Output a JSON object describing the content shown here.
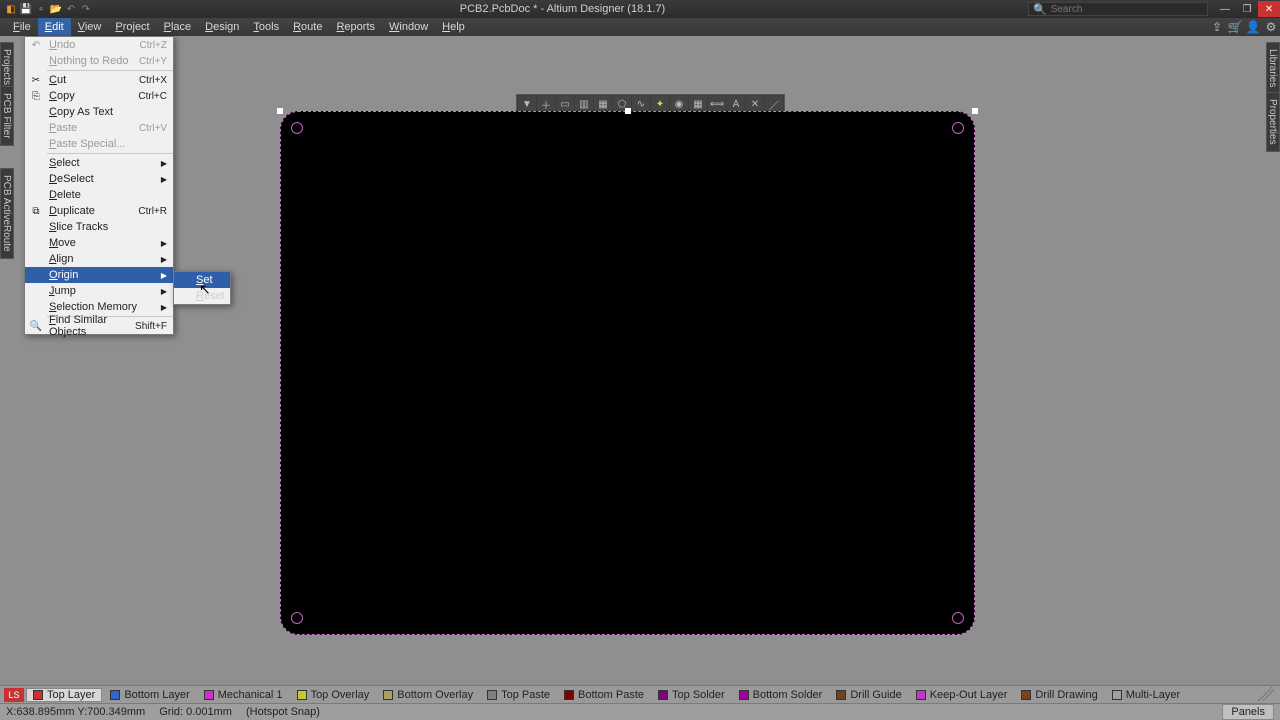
{
  "title": "PCB2.PcbDoc * - Altium Designer (18.1.7)",
  "search_placeholder": "Search",
  "menus": [
    "File",
    "Edit",
    "View",
    "Project",
    "Place",
    "Design",
    "Tools",
    "Route",
    "Reports",
    "Window",
    "Help"
  ],
  "active_menu_index": 1,
  "edit_menu": [
    {
      "label": "Undo",
      "shortcut": "Ctrl+Z",
      "icon": "undo",
      "disabled": true
    },
    {
      "label": "Nothing to Redo",
      "shortcut": "Ctrl+Y",
      "disabled": true
    },
    {
      "sep": true
    },
    {
      "label": "Cut",
      "shortcut": "Ctrl+X",
      "icon": "cut"
    },
    {
      "label": "Copy",
      "shortcut": "Ctrl+C",
      "icon": "copy"
    },
    {
      "label": "Copy As Text"
    },
    {
      "label": "Paste",
      "shortcut": "Ctrl+V",
      "disabled": true
    },
    {
      "label": "Paste Special...",
      "disabled": true
    },
    {
      "sep": true
    },
    {
      "label": "Select",
      "submenu": true
    },
    {
      "label": "DeSelect",
      "submenu": true
    },
    {
      "label": "Delete"
    },
    {
      "label": "Duplicate",
      "shortcut": "Ctrl+R",
      "icon": "duplicate"
    },
    {
      "label": "Slice Tracks"
    },
    {
      "label": "Move",
      "submenu": true
    },
    {
      "label": "Align",
      "submenu": true
    },
    {
      "label": "Origin",
      "submenu": true,
      "highlight": true
    },
    {
      "label": "Jump",
      "submenu": true
    },
    {
      "label": "Selection Memory",
      "submenu": true
    },
    {
      "sep": true
    },
    {
      "label": "Find Similar Objects",
      "shortcut": "Shift+F",
      "icon": "find"
    }
  ],
  "origin_submenu": [
    {
      "label": "Set",
      "highlight": true
    },
    {
      "label": "Reset"
    }
  ],
  "side_tabs_left": [
    "Projects",
    "PCB Filter",
    "PCB ActiveRoute"
  ],
  "side_tabs_right": [
    "Libraries",
    "Properties"
  ],
  "layers": [
    {
      "name": "LS",
      "color": "#c83232",
      "ls": true
    },
    {
      "name": "Top Layer",
      "color": "#c83232",
      "active": true
    },
    {
      "name": "Bottom Layer",
      "color": "#3264c8"
    },
    {
      "name": "Mechanical 1",
      "color": "#c832c8"
    },
    {
      "name": "Top Overlay",
      "color": "#c8c832"
    },
    {
      "name": "Bottom Overlay",
      "color": "#aca060"
    },
    {
      "name": "Top Paste",
      "color": "#808080"
    },
    {
      "name": "Bottom Paste",
      "color": "#800000"
    },
    {
      "name": "Top Solder",
      "color": "#800080"
    },
    {
      "name": "Bottom Solder",
      "color": "#a000a0"
    },
    {
      "name": "Drill Guide",
      "color": "#704020"
    },
    {
      "name": "Keep-Out Layer",
      "color": "#c832c8"
    },
    {
      "name": "Drill Drawing",
      "color": "#804020"
    },
    {
      "name": "Multi-Layer",
      "color": "#a0a0a0"
    }
  ],
  "status": {
    "coord": "X:638.895mm Y:700.349mm",
    "grid": "Grid: 0.001mm",
    "snap": "(Hotspot Snap)",
    "panels": "Panels"
  },
  "float_toolbar": [
    "filter",
    "plus",
    "rect",
    "bar",
    "fill",
    "poly",
    "trace",
    "flash",
    "pad",
    "grid",
    "dim",
    "text",
    "xout",
    "line"
  ]
}
